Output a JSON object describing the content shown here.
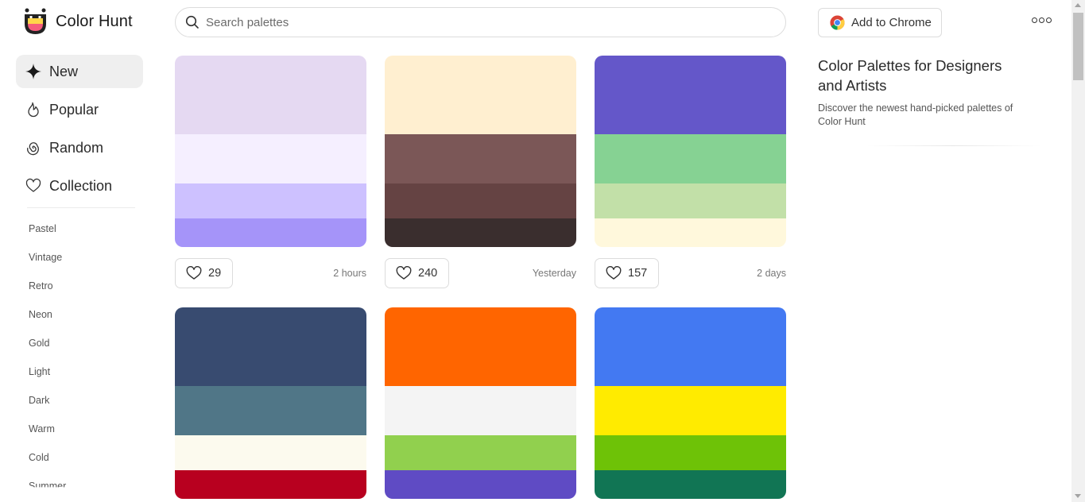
{
  "header": {
    "logo_text": "Color Hunt",
    "search_placeholder": "Search palettes",
    "chrome_button": "Add to Chrome",
    "more_icon": "more-dots-icon"
  },
  "sidebar": {
    "nav": [
      {
        "label": "New",
        "icon": "sparkle-icon",
        "active": true
      },
      {
        "label": "Popular",
        "icon": "flame-icon",
        "active": false
      },
      {
        "label": "Random",
        "icon": "spiral-icon",
        "active": false
      },
      {
        "label": "Collection",
        "icon": "heart-icon",
        "active": false
      }
    ],
    "tags": [
      "Pastel",
      "Vintage",
      "Retro",
      "Neon",
      "Gold",
      "Light",
      "Dark",
      "Warm",
      "Cold",
      "Summer"
    ]
  },
  "palettes": [
    {
      "colors": [
        "#E5D9F2",
        "#F5EFFF",
        "#CDC1FF",
        "#A594F9"
      ],
      "likes": "29",
      "time": "2 hours"
    },
    {
      "colors": [
        "#FFEFD0",
        "#7B5757",
        "#654343",
        "#3A2E2E"
      ],
      "likes": "240",
      "time": "Yesterday"
    },
    {
      "colors": [
        "#6457C9",
        "#86D293",
        "#C2E0A8",
        "#FFF8DC"
      ],
      "likes": "157",
      "time": "2 days"
    },
    {
      "colors": [
        "#384B70",
        "#507687",
        "#FCFAEE",
        "#B8001F"
      ],
      "likes": "",
      "time": ""
    },
    {
      "colors": [
        "#FF6500",
        "#F4F4F4",
        "#91D04E",
        "#5F4BC4"
      ],
      "likes": "",
      "time": ""
    },
    {
      "colors": [
        "#4379F2",
        "#FFEB00",
        "#6EC207",
        "#117554"
      ],
      "likes": "",
      "time": ""
    }
  ],
  "info": {
    "title": "Color Palettes for Designers and Artists",
    "description": "Discover the newest hand-picked palettes of Color Hunt"
  }
}
